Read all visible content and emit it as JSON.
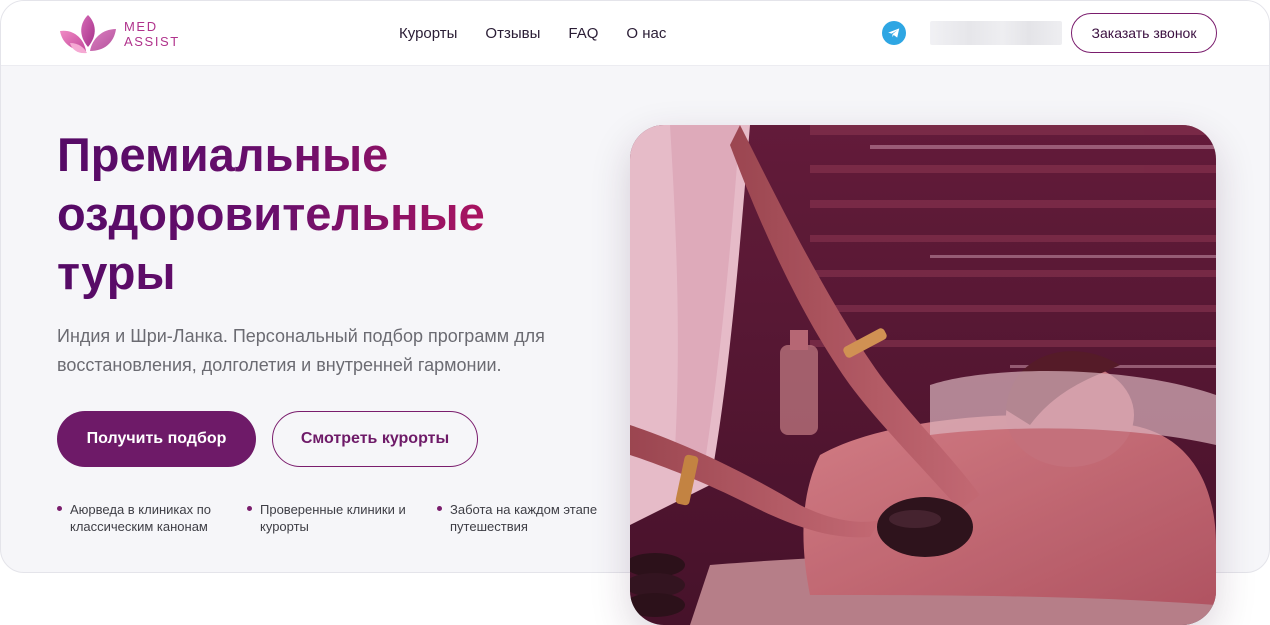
{
  "brand": {
    "line1": "MED",
    "line2": "ASSIST",
    "icon": "lotus-logo-icon",
    "color": "#c23b8f"
  },
  "nav": {
    "items": [
      "Курорты",
      "Отзывы",
      "FAQ",
      "О нас"
    ]
  },
  "header": {
    "telegram_icon": "telegram-icon",
    "phone": "",
    "call_button": "Заказать звонок"
  },
  "hero": {
    "title_line1": "Премиальные",
    "title_line2": "оздоровительные",
    "title_line3": "туры",
    "subtitle": "Индия и Шри-Ланка. Персональный подбор программ для восстановления, долголетия и внутренней гармонии.",
    "primary_button": "Получить подбор",
    "secondary_button": "Смотреть курорты",
    "features": [
      "Аюрведа в клиниках по классическим канонам",
      "Проверенные клиники и курорты",
      "Забота на каждом этапе путешествия"
    ],
    "image": "ayurvedic-hot-stone-massage-photo"
  },
  "colors": {
    "accent": "#6e1a68",
    "title_gradient_end": "#b0145f",
    "telegram": "#2ea6e3",
    "background": "#f6f6f9"
  }
}
